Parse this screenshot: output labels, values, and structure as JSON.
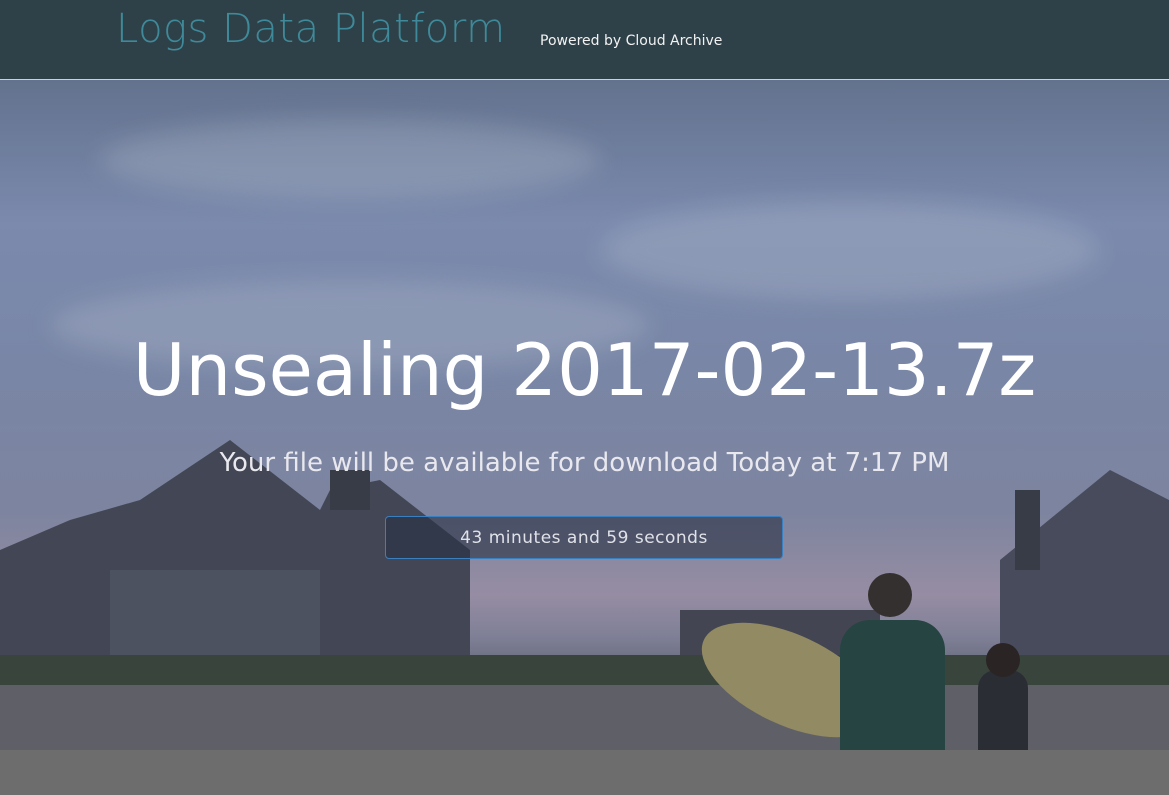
{
  "header": {
    "brand": "Logs Data Platform",
    "tagline": "Powered by Cloud Archive"
  },
  "main": {
    "title": "Unsealing 2017-02-13.7z",
    "subtitle": "Your file will be available for download Today at 7:17 PM",
    "countdown": "43 minutes and 59 seconds"
  },
  "colors": {
    "header_bg": "#2f4148",
    "brand": "#3e8a9a",
    "timer_border": "#3a7fc0"
  }
}
